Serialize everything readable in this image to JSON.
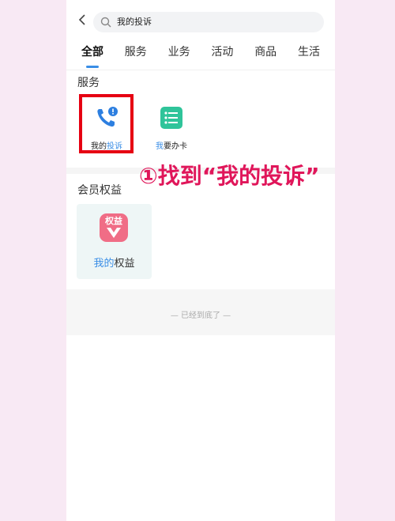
{
  "search": {
    "query": "我的投诉"
  },
  "tabs": [
    "全部",
    "服务",
    "业务",
    "活动",
    "商品",
    "生活"
  ],
  "services_section": {
    "title": "服务",
    "items": [
      {
        "label_prefix": "我的",
        "label_highlight": "投诉"
      },
      {
        "label_prefix": "",
        "label_highlight": "我",
        "label_suffix": "要办卡"
      }
    ]
  },
  "callout": "①找到“我的投诉”",
  "membership_section": {
    "title": "会员权益",
    "card_label_prefix": "我的",
    "card_label_rest": "权益",
    "badge_text": "权益"
  },
  "footer": {
    "end_text": "— 已经到底了 —"
  },
  "colors": {
    "accent": "#3a8ee6",
    "highlight_frame": "#e60012",
    "callout": "#e0165a"
  }
}
